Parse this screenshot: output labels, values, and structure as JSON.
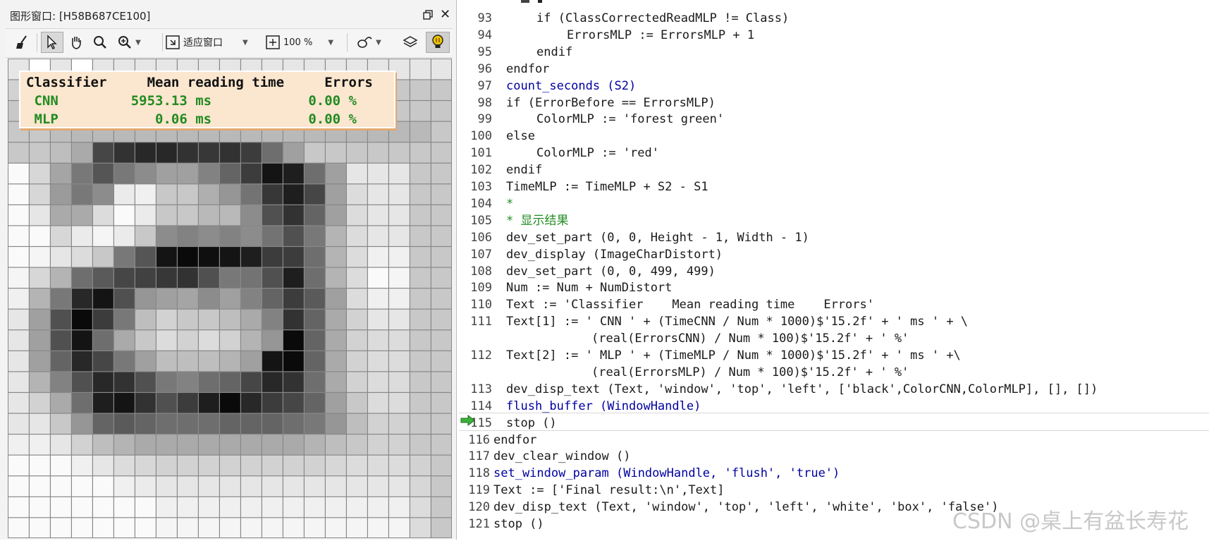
{
  "graphics_window": {
    "title": "图形窗口: [H58B687CE100]",
    "toolbar": {
      "fit_label": "适应窗口",
      "zoom_label": "100 %"
    },
    "overlay": {
      "header": "Classifier     Mean reading time     Errors",
      "row1": " CNN         5953.13 ms            0.00 %",
      "row2": " MLP            0.06 ms            0.00 %",
      "header_color": "#000000",
      "row_color": "#228b22"
    },
    "grid_image": {
      "cols": 21,
      "rows": 23,
      "cell_values": [
        [
          230,
          255,
          230,
          255,
          230,
          230,
          230,
          230,
          230,
          230,
          230,
          230,
          230,
          230,
          230,
          230,
          230,
          230,
          230,
          230,
          230
        ],
        [
          210,
          200,
          200,
          200,
          200,
          200,
          200,
          200,
          200,
          200,
          200,
          200,
          200,
          200,
          200,
          200,
          200,
          200,
          200,
          200,
          200
        ],
        [
          200,
          200,
          200,
          200,
          200,
          200,
          200,
          200,
          200,
          200,
          200,
          200,
          200,
          200,
          200,
          200,
          200,
          200,
          200,
          200,
          200
        ],
        [
          200,
          200,
          190,
          185,
          185,
          185,
          185,
          185,
          185,
          185,
          185,
          185,
          185,
          185,
          185,
          185,
          185,
          185,
          185,
          185,
          200
        ],
        [
          200,
          200,
          190,
          170,
          70,
          50,
          40,
          40,
          50,
          55,
          50,
          60,
          110,
          160,
          200,
          200,
          200,
          200,
          200,
          200,
          200
        ],
        [
          250,
          215,
          165,
          120,
          85,
          120,
          140,
          160,
          160,
          130,
          100,
          60,
          20,
          30,
          110,
          160,
          230,
          230,
          230,
          200,
          200
        ],
        [
          250,
          215,
          155,
          120,
          140,
          235,
          240,
          200,
          200,
          175,
          150,
          115,
          55,
          30,
          70,
          160,
          220,
          230,
          230,
          200,
          200
        ],
        [
          250,
          230,
          170,
          170,
          220,
          250,
          235,
          200,
          200,
          185,
          185,
          140,
          80,
          50,
          100,
          160,
          220,
          230,
          230,
          200,
          200
        ],
        [
          250,
          250,
          215,
          235,
          245,
          235,
          200,
          140,
          130,
          140,
          130,
          140,
          115,
          80,
          120,
          180,
          220,
          230,
          230,
          200,
          200
        ],
        [
          250,
          245,
          230,
          220,
          200,
          120,
          85,
          20,
          10,
          15,
          20,
          30,
          60,
          60,
          110,
          180,
          220,
          240,
          240,
          200,
          200
        ],
        [
          245,
          215,
          180,
          110,
          90,
          70,
          65,
          55,
          50,
          80,
          120,
          115,
          80,
          30,
          110,
          180,
          220,
          250,
          245,
          200,
          200
        ],
        [
          240,
          180,
          120,
          40,
          20,
          80,
          150,
          160,
          165,
          140,
          160,
          130,
          100,
          60,
          90,
          160,
          220,
          240,
          240,
          200,
          200
        ],
        [
          230,
          160,
          80,
          10,
          60,
          120,
          190,
          210,
          200,
          200,
          190,
          170,
          130,
          50,
          100,
          170,
          210,
          230,
          230,
          200,
          200
        ],
        [
          230,
          160,
          80,
          20,
          110,
          170,
          200,
          220,
          210,
          220,
          210,
          180,
          150,
          10,
          100,
          170,
          210,
          220,
          220,
          200,
          200
        ],
        [
          230,
          160,
          100,
          40,
          70,
          120,
          160,
          190,
          190,
          190,
          180,
          160,
          20,
          10,
          100,
          170,
          210,
          220,
          220,
          200,
          200
        ],
        [
          230,
          180,
          130,
          80,
          40,
          50,
          80,
          120,
          130,
          110,
          100,
          70,
          40,
          50,
          110,
          170,
          210,
          220,
          220,
          200,
          200
        ],
        [
          230,
          210,
          170,
          110,
          30,
          20,
          50,
          80,
          60,
          30,
          10,
          40,
          60,
          70,
          100,
          160,
          200,
          220,
          220,
          200,
          200
        ],
        [
          230,
          230,
          200,
          150,
          100,
          90,
          100,
          110,
          110,
          110,
          100,
          100,
          100,
          110,
          120,
          150,
          190,
          210,
          210,
          200,
          200
        ],
        [
          240,
          240,
          230,
          210,
          190,
          180,
          170,
          170,
          170,
          170,
          170,
          170,
          170,
          170,
          180,
          190,
          200,
          210,
          210,
          200,
          200
        ],
        [
          250,
          250,
          250,
          240,
          230,
          220,
          215,
          210,
          210,
          210,
          210,
          210,
          210,
          210,
          210,
          215,
          220,
          220,
          220,
          210,
          200
        ],
        [
          250,
          250,
          250,
          250,
          250,
          240,
          235,
          230,
          230,
          230,
          230,
          230,
          230,
          230,
          230,
          230,
          230,
          230,
          230,
          215,
          200
        ],
        [
          250,
          250,
          250,
          250,
          250,
          250,
          250,
          240,
          240,
          240,
          240,
          240,
          240,
          240,
          240,
          240,
          240,
          240,
          240,
          220,
          200
        ],
        [
          250,
          250,
          250,
          250,
          250,
          250,
          250,
          245,
          245,
          245,
          245,
          245,
          245,
          245,
          245,
          245,
          245,
          245,
          245,
          220,
          200
        ]
      ]
    }
  },
  "editor": {
    "lines": [
      {
        "n": "93",
        "indent": 2,
        "text": "if (ClassCorrectedReadMLP != Class)",
        "color": "normal"
      },
      {
        "n": "94",
        "indent": 3,
        "text": "ErrorsMLP := ErrorsMLP + 1",
        "color": "normal"
      },
      {
        "n": "95",
        "indent": 2,
        "text": "endif",
        "color": "normal"
      },
      {
        "n": "96",
        "indent": 1,
        "text": "endfor",
        "color": "normal"
      },
      {
        "n": "97",
        "indent": 1,
        "text": "count_seconds (S2)",
        "color": "blue"
      },
      {
        "n": "98",
        "indent": 1,
        "text": "if (ErrorBefore == ErrorsMLP)",
        "color": "normal"
      },
      {
        "n": "99",
        "indent": 2,
        "text": "ColorMLP := 'forest green'",
        "color": "normal"
      },
      {
        "n": "100",
        "indent": 1,
        "text": "else",
        "color": "normal"
      },
      {
        "n": "101",
        "indent": 2,
        "text": "ColorMLP := 'red'",
        "color": "normal"
      },
      {
        "n": "102",
        "indent": 1,
        "text": "endif",
        "color": "normal"
      },
      {
        "n": "103",
        "indent": 1,
        "text": "TimeMLP := TimeMLP + S2 - S1",
        "color": "normal"
      },
      {
        "n": "104",
        "indent": 1,
        "text": "*",
        "color": "green"
      },
      {
        "n": "105",
        "indent": 1,
        "text": "* 显示结果",
        "color": "green"
      },
      {
        "n": "106",
        "indent": 1,
        "text": "dev_set_part (0, 0, Height - 1, Width - 1)",
        "color": "normal"
      },
      {
        "n": "107",
        "indent": 1,
        "text": "dev_display (ImageCharDistort)",
        "color": "normal"
      },
      {
        "n": "108",
        "indent": 1,
        "text": "dev_set_part (0, 0, 499, 499)",
        "color": "normal"
      },
      {
        "n": "109",
        "indent": 1,
        "text": "Num := Num + NumDistort",
        "color": "normal"
      },
      {
        "n": "110",
        "indent": 1,
        "text": "Text := 'Classifier    Mean reading time    Errors'",
        "color": "normal"
      },
      {
        "n": "111",
        "indent": 1,
        "text": "Text[1] := ' CNN ' + (TimeCNN / Num * 1000)$'15.2f' + ' ms ' + \\",
        "color": "normal"
      },
      {
        "n": "",
        "indent": 4,
        "text": "(real(ErrorsCNN) / Num * 100)$'15.2f' + ' %'",
        "color": "normal"
      },
      {
        "n": "112",
        "indent": 1,
        "text": "Text[2] := ' MLP ' + (TimeMLP / Num * 1000)$'15.2f' + ' ms ' +\\",
        "color": "normal"
      },
      {
        "n": "",
        "indent": 4,
        "text": "(real(ErrorsMLP) / Num * 100)$'15.2f' + ' %'",
        "color": "normal"
      },
      {
        "n": "113",
        "indent": 1,
        "text": "dev_disp_text (Text, 'window', 'top', 'left', ['black',ColorCNN,ColorMLP], [], [])",
        "color": "normal"
      },
      {
        "n": "114",
        "indent": 1,
        "text": "flush_buffer (WindowHandle)",
        "color": "blue"
      },
      {
        "n": "115",
        "indent": 1,
        "text": "stop ()",
        "color": "normal"
      },
      {
        "n": "116",
        "indent": 0,
        "text": "endfor",
        "color": "normal"
      },
      {
        "n": "117",
        "indent": 0,
        "text": "dev_clear_window ()",
        "color": "normal"
      },
      {
        "n": "118",
        "indent": 0,
        "text": "set_window_param (WindowHandle, 'flush', 'true')",
        "color": "blue"
      },
      {
        "n": "119",
        "indent": 0,
        "text": "Text := ['Final result:\\n',Text]",
        "color": "normal"
      },
      {
        "n": "120",
        "indent": 0,
        "text": "dev_disp_text (Text, 'window', 'top', 'left', 'white', 'box', 'false')",
        "color": "normal"
      },
      {
        "n": "121",
        "indent": 0,
        "text": "stop ()",
        "color": "normal"
      }
    ],
    "current_line": "115"
  },
  "watermark": "CSDN @桌上有盆长寿花",
  "colors": {
    "keyword_blue": "#0000a0",
    "comment_green": "#228b22",
    "overlay_bg": "#fbe6cf"
  }
}
